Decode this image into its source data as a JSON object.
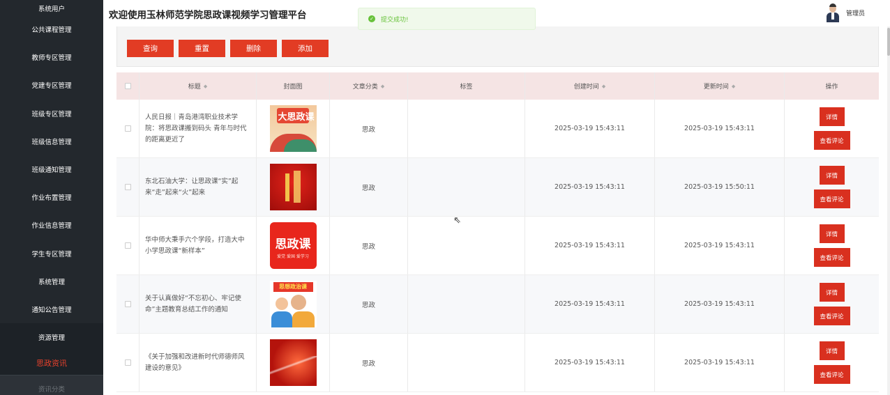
{
  "app": {
    "title": "欢迎使用玉林师范学院思政课视频学习管理平台",
    "user_name": "管理员"
  },
  "toast": {
    "icon": "success-check-icon",
    "text": "提交成功!"
  },
  "sidebar": {
    "items": [
      {
        "label": "系统用户"
      },
      {
        "label": "公共课程管理"
      },
      {
        "label": "教师专区管理"
      },
      {
        "label": "党建专区管理"
      },
      {
        "label": "班级专区管理"
      },
      {
        "label": "班级信息管理"
      },
      {
        "label": "班级通知管理"
      },
      {
        "label": "作业布置管理"
      },
      {
        "label": "作业信息管理"
      },
      {
        "label": "学生专区管理"
      },
      {
        "label": "系统管理"
      },
      {
        "label": "通知公告管理"
      },
      {
        "label": "资源管理"
      },
      {
        "label": "思政资讯"
      },
      {
        "label": "资讯分类"
      }
    ]
  },
  "toolbar": {
    "query_label": "查询",
    "reset_label": "重置",
    "delete_label": "删除",
    "add_label": "添加",
    "accent_color": "#e23c24"
  },
  "table": {
    "headers": {
      "title": "标题",
      "cover": "封面图",
      "category": "文章分类",
      "tags": "标签",
      "created": "创建时间",
      "updated": "更新时间",
      "actions": "操作"
    },
    "detail_label": "详情",
    "comment_label": "查看评论",
    "rows": [
      {
        "title": "人民日报｜青岛港湾职业技术学院：将思政课搬到码头 青年与时代的距离更近了",
        "category": "思政",
        "tags": "",
        "created": "2025-03-19 15:43:11",
        "updated": "2025-03-19 15:43:11"
      },
      {
        "title": "东北石油大学：让思政课“实”起来“走”起来“火”起来",
        "category": "思政",
        "tags": "",
        "created": "2025-03-19 15:43:11",
        "updated": "2025-03-19 15:50:11"
      },
      {
        "title": "华中师大秉手六个学段，打造大中小学思政课“新样本”",
        "category": "思政",
        "tags": "",
        "created": "2025-03-19 15:43:11",
        "updated": "2025-03-19 15:43:11"
      },
      {
        "title": "关于认真做好“不忘初心、牢记使命”主题教育总结工作的通知",
        "category": "思政",
        "tags": "",
        "created": "2025-03-19 15:43:11",
        "updated": "2025-03-19 15:43:11"
      },
      {
        "title": "《关于加强和改进新时代师德师风建设的意见》",
        "category": "思政",
        "tags": "",
        "created": "2025-03-19 15:43:11",
        "updated": "2025-03-19 15:43:11"
      }
    ]
  },
  "covers": {
    "c1_text": "大思政课",
    "c3_big": "思政课",
    "c3_small": "爱党 爱国 爱学习",
    "c4_banner": "思想政治课"
  }
}
